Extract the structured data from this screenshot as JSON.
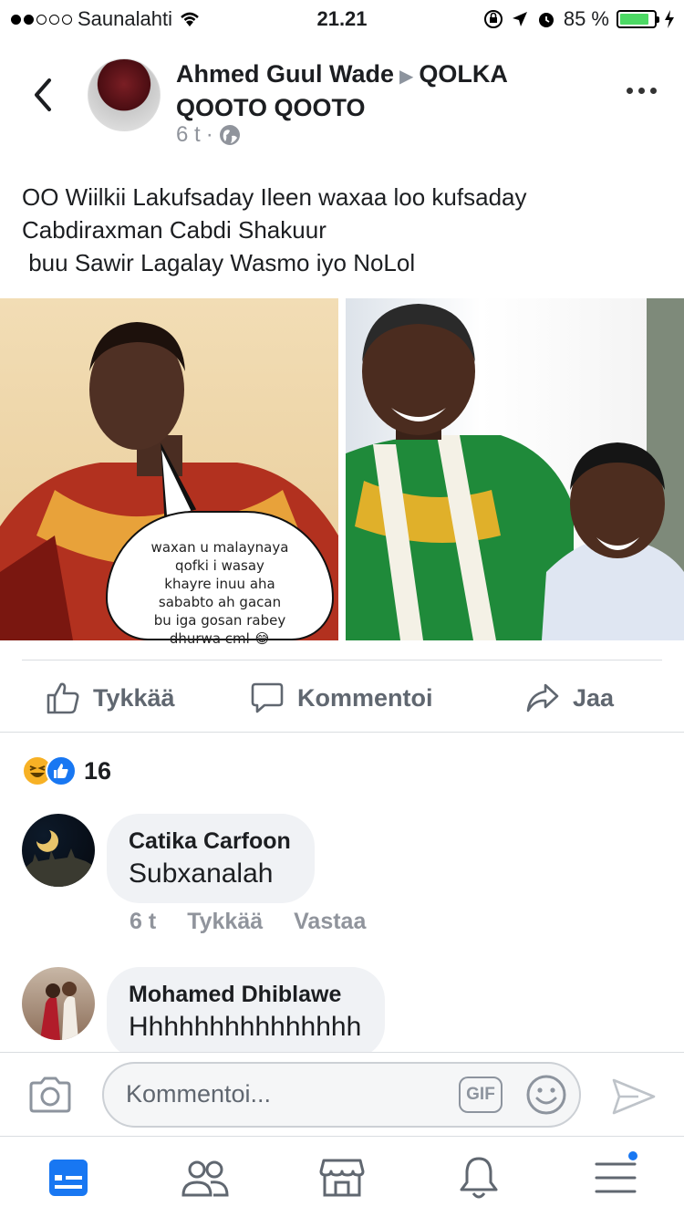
{
  "status_bar": {
    "carrier": "Saunalahti",
    "time": "21.21",
    "battery_percent": "85 %",
    "battery_level": 0.85,
    "signal_bars_filled": 2,
    "signal_bars_total": 5
  },
  "post": {
    "author": "Ahmed Guul Wade",
    "group": "QOLKA QOOTO QOOTO",
    "time": "6 t",
    "text_lines": [
      "OO Wiilkii Lakufsaday Ileen waxaa loo kufsaday",
      "Cabdiraxman Cabdi Shakuur",
      " buu Sawir Lagalay Wasmo iyo NoLol"
    ],
    "image_caption_lines": [
      "waxan u malaynaya",
      "qofki i wasay",
      "khayre inuu aha",
      "sababto ah gacan",
      "bu iga gosan rabey",
      "dhurwa cml 😂"
    ]
  },
  "actions": {
    "like": "Tykkää",
    "comment": "Kommentoi",
    "share": "Jaa"
  },
  "reactions": {
    "count": "16"
  },
  "comments": [
    {
      "name": "Catika Carfoon",
      "text": "Subxanalah",
      "time": "6 t",
      "like": "Tykkää",
      "reply": "Vastaa"
    },
    {
      "name": "Mohamed Dhiblawe",
      "text": "Hhhhhhhhhhhhhhh"
    }
  ],
  "composer": {
    "placeholder": "Kommentoi...",
    "gif_label": "GIF"
  },
  "colors": {
    "accent": "#1877f2",
    "text": "#1c1e21",
    "secondary": "#606770",
    "battery": "#4cd964"
  },
  "icons": {
    "back": "chevron-left-icon",
    "more": "more-icon",
    "globe": "globe-icon",
    "like": "thumbs-up-icon",
    "comment": "comment-icon",
    "share": "share-icon",
    "camera": "camera-icon",
    "emoji": "smiley-icon",
    "send": "send-icon",
    "tabs": [
      "news-feed-icon",
      "friends-icon",
      "marketplace-icon",
      "notifications-icon",
      "menu-icon"
    ]
  }
}
